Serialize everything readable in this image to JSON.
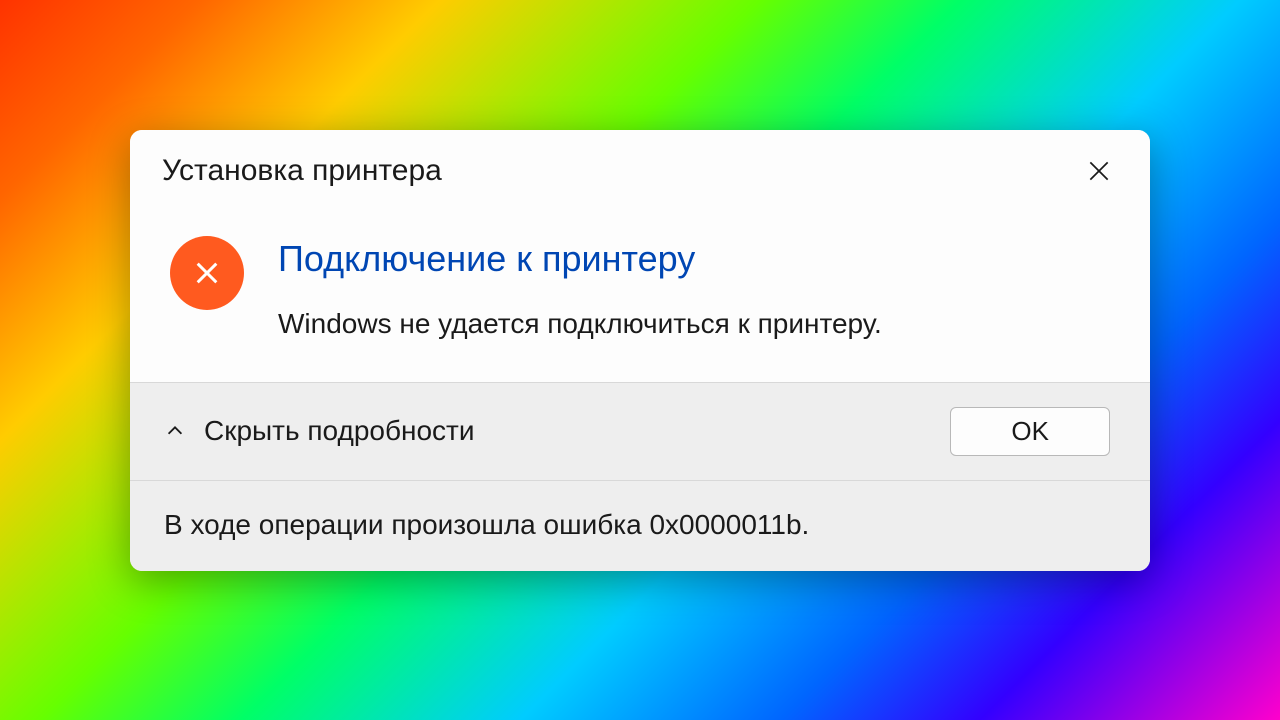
{
  "dialog": {
    "title": "Установка принтера",
    "heading": "Подключение к принтеру",
    "message": "Windows не удается подключиться к принтеру.",
    "details_toggle_label": "Скрыть подробности",
    "ok_label": "OK",
    "error_details": "В ходе операции произошла ошибка 0x0000011b."
  },
  "colors": {
    "accent": "#0046b3",
    "error_icon": "#ff5a1f"
  }
}
